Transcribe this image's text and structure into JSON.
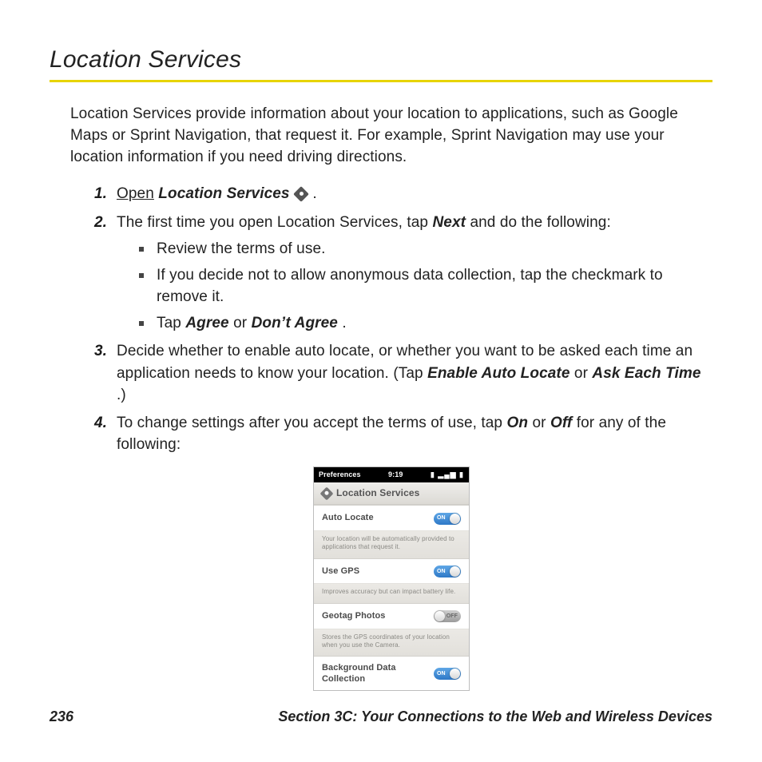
{
  "title": "Location Services",
  "intro": "Location Services provide information about your location to applications, such as Google Maps or Sprint Navigation, that request it. For example, Sprint Navigation may use your location information if you need driving directions.",
  "steps": {
    "s1_a": "Open",
    "s1_b": "Location Services",
    "s1_c": ".",
    "s2_a": "The first time you open Location Services, tap ",
    "s2_b": "Next",
    "s2_c": " and do the following:",
    "s2_sub1": " Review the terms of use.",
    "s2_sub2": "If you decide not to allow anonymous data collection, tap the checkmark to remove it.",
    "s2_sub3a": "Tap ",
    "s2_sub3b": "Agree",
    "s2_sub3c": " or ",
    "s2_sub3d": "Don’t Agree",
    "s2_sub3e": ".",
    "s3_a": "Decide whether to enable auto locate, or whether you want to be asked each time an application needs to know your location. (Tap ",
    "s3_b": "Enable Auto Locate",
    "s3_c": " or ",
    "s3_d": "Ask Each Time",
    "s3_e": ".)",
    "s4_a": "To change settings after you accept the terms of use, tap ",
    "s4_b": "On",
    "s4_c": " or ",
    "s4_d": "Off",
    "s4_e": " for any of the following:"
  },
  "nums": {
    "n1": "1.",
    "n2": "2.",
    "n3": "3.",
    "n4": "4."
  },
  "shot": {
    "status_left": "Preferences",
    "status_time": "9:19",
    "header": "Location Services",
    "row1": "Auto Locate",
    "row1_on": "ON",
    "note1": "Your location will be automatically provided to applications that request it.",
    "row2": "Use GPS",
    "row2_on": "ON",
    "note2": "Improves accuracy but can impact battery life.",
    "row3": "Geotag Photos",
    "row3_off": "OFF",
    "note3": "Stores the GPS coordinates of your location when you use the Camera.",
    "row4": "Background Data Collection",
    "row4_on": "ON"
  },
  "footer": {
    "page": "236",
    "section": "Section 3C: Your Connections to the Web and Wireless Devices"
  }
}
